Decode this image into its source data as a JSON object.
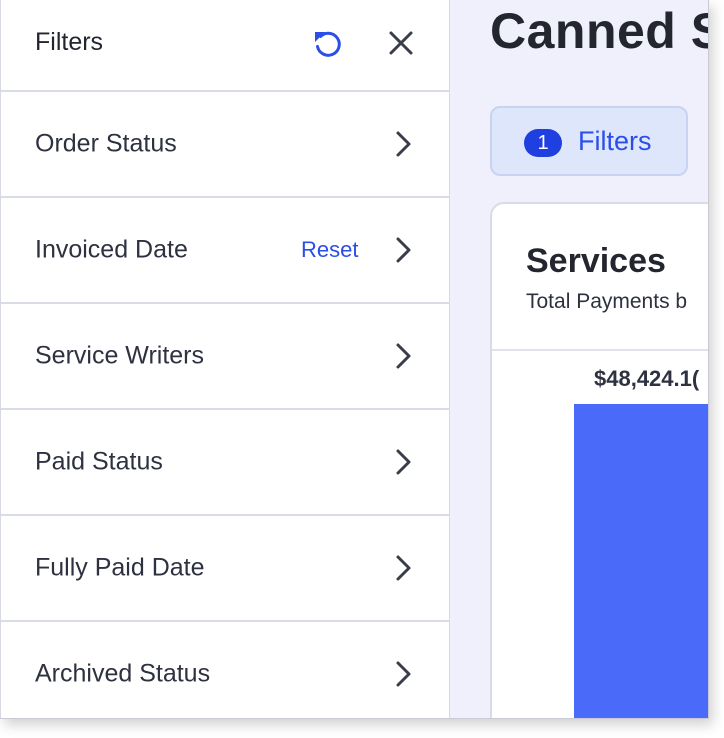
{
  "panel": {
    "title": "Filters",
    "items": [
      {
        "label": "Order Status"
      },
      {
        "label": "Invoiced Date",
        "reset": "Reset"
      },
      {
        "label": "Service Writers"
      },
      {
        "label": "Paid Status"
      },
      {
        "label": "Fully Paid Date"
      },
      {
        "label": "Archived Status"
      }
    ],
    "icons": {
      "reset_all": "refresh-icon",
      "close": "close-icon",
      "row": "chevron-right-icon"
    }
  },
  "main": {
    "page_title": "Canned S",
    "filters_chip": {
      "count": "1",
      "label": "Filters"
    },
    "card": {
      "title": "Services",
      "subtitle": "Total Payments b",
      "bar_value_label": "$48,424.1("
    }
  },
  "colors": {
    "accent": "#2b4ee8",
    "badge": "#1f3fe0",
    "bar": "#4a6bfa",
    "chip_bg": "#dde6fb",
    "page_bg": "#eff0fb"
  }
}
